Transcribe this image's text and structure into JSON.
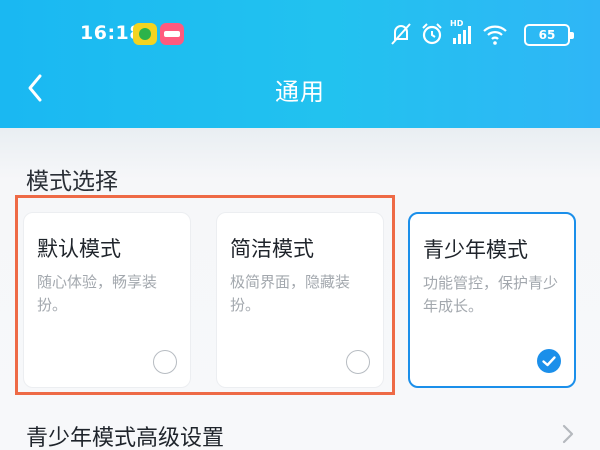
{
  "status_bar": {
    "time": "16:18",
    "battery": "65",
    "network_label": "HD",
    "icons": [
      "mute-icon",
      "alarm-icon",
      "signal-icon",
      "wifi-icon",
      "battery-icon"
    ]
  },
  "nav": {
    "title": "通用",
    "back_icon": "chevron-left-icon"
  },
  "mode_section": {
    "title": "模式选择",
    "cards": [
      {
        "title": "默认模式",
        "desc": "随心体验，畅享装扮。",
        "selected": false
      },
      {
        "title": "简洁模式",
        "desc": "极简界面，隐藏装扮。",
        "selected": false
      },
      {
        "title": "青少年模式",
        "desc": "功能管控，保护青少年成长。",
        "selected": true
      }
    ]
  },
  "advanced_row": {
    "label": "青少年模式高级设置"
  },
  "colors": {
    "header_gradient_start": "#1ab8f2",
    "header_gradient_end": "#2fb6f6",
    "accent": "#1b8fea",
    "highlight_box": "#ee6a46"
  }
}
